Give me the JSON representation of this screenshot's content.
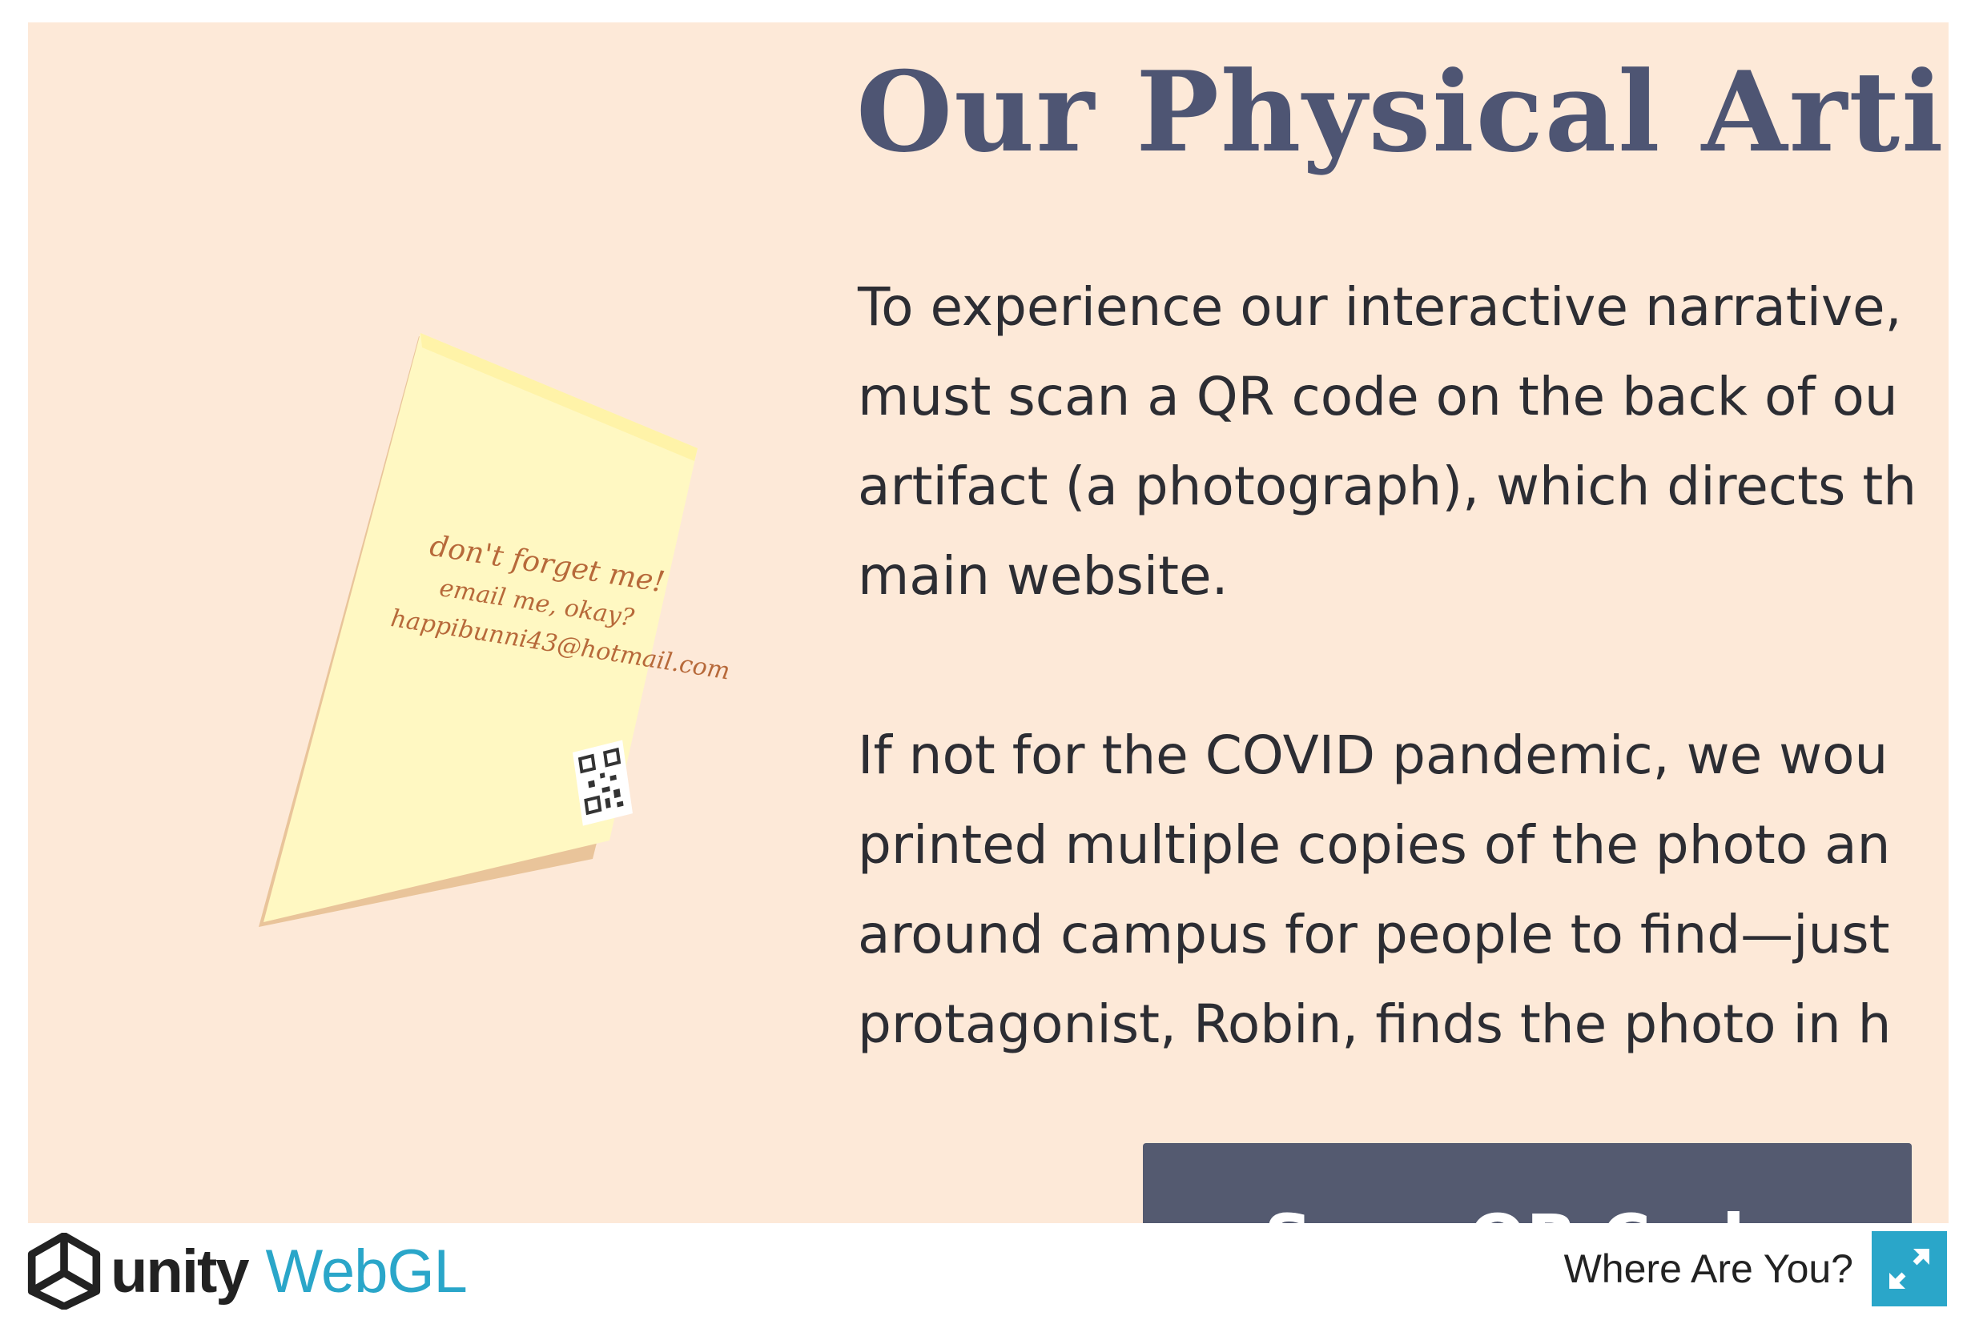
{
  "content": {
    "heading": "Our Physical Arti",
    "paragraph_1": "To experience our interactive narrative,\nmust scan a QR code on the back of ou\nartifact (a photograph), which directs th\nmain website.",
    "paragraph_2": "If not for the COVID pandemic, we wou\nprinted multiple copies of the photo an\naround campus for people to find—just\nprotagonist, Robin, finds the photo in h",
    "scan_button": "Scan QR Code"
  },
  "photo": {
    "line_1": "don't forget me!",
    "line_2": "email me, okay?",
    "line_3": "happibunni43@hotmail.com"
  },
  "footer": {
    "unity": "unity",
    "webgl": "WebGL",
    "title": "Where Are You?"
  },
  "colors": {
    "canvas_bg": "#fde9d8",
    "heading": "#4e5573",
    "button": "#545a70",
    "webgl_accent": "#2aa6c9"
  },
  "icons": {
    "logo": "unity-logo-icon",
    "fullscreen": "fullscreen-icon",
    "qr": "qr-code-icon"
  }
}
